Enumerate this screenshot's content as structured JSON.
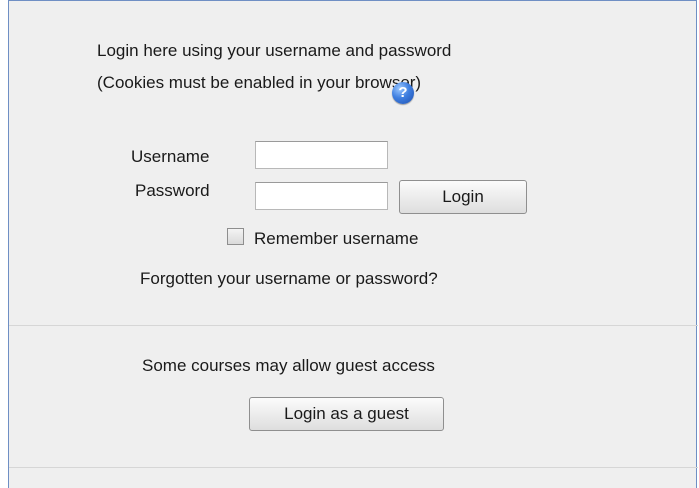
{
  "login": {
    "intro_line1": "Login here using your username and password",
    "intro_line2": "(Cookies must be enabled in your browser)",
    "help_icon": "question-circle-icon",
    "username_label": "Username",
    "username_value": "",
    "password_label": "Password",
    "password_value": "",
    "login_button": "Login",
    "remember_label": "Remember username",
    "remember_checked": false,
    "forgot_link": "Forgotten your username or password?"
  },
  "guest": {
    "message": "Some courses may allow guest access",
    "button": "Login as a guest"
  },
  "colors": {
    "panel_bg": "#efefef",
    "border": "#6f8fc4",
    "help_icon": "#3f7fe0"
  }
}
